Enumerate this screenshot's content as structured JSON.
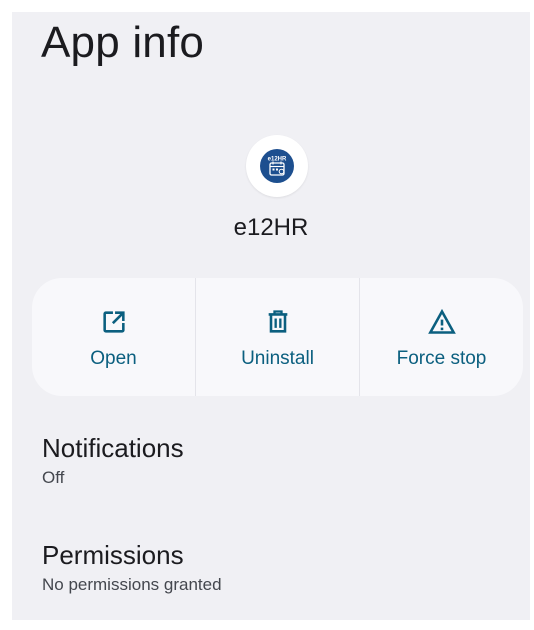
{
  "header": {
    "title": "App info"
  },
  "app": {
    "name": "e12HR",
    "icon": "e12hr-app-icon",
    "icon_text": "e12HR"
  },
  "actions": [
    {
      "label": "Open",
      "icon": "open-external-icon"
    },
    {
      "label": "Uninstall",
      "icon": "trash-icon"
    },
    {
      "label": "Force stop",
      "icon": "warning-icon"
    }
  ],
  "settings": {
    "notifications": {
      "title": "Notifications",
      "summary": "Off"
    },
    "permissions": {
      "title": "Permissions",
      "summary": "No permissions granted"
    }
  },
  "colors": {
    "background": "#f0f0f4",
    "card": "#f8f8fb",
    "accent": "#0b5f7f",
    "app_icon_bg": "#1d4f8f"
  }
}
